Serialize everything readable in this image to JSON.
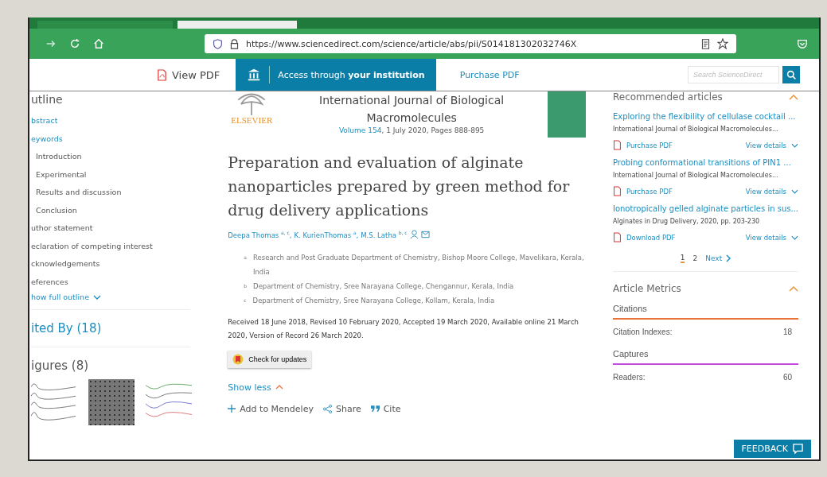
{
  "browser": {
    "url": "https://www.sciencedirect.com/science/article/abs/pii/S014181302032746X"
  },
  "header": {
    "view_pdf": "View PDF",
    "access": {
      "prefix": "Access through ",
      "bold": "your institution"
    },
    "purchase": "Purchase PDF",
    "search": {
      "placeholder": "Search ScienceDirect"
    }
  },
  "outline": {
    "title": "utline",
    "items": [
      {
        "label": "bstract",
        "kind": "link"
      },
      {
        "label": "eywords",
        "kind": "link"
      },
      {
        "label": "Introduction",
        "kind": "section"
      },
      {
        "label": "Experimental",
        "kind": "section"
      },
      {
        "label": "Results and discussion",
        "kind": "section"
      },
      {
        "label": "Conclusion",
        "kind": "section"
      },
      {
        "label": "uthor statement",
        "kind": "plain"
      },
      {
        "label": "eclaration of competing interest",
        "kind": "plain"
      },
      {
        "label": "cknowledgements",
        "kind": "plain"
      },
      {
        "label": "eferences",
        "kind": "plain"
      }
    ],
    "show_full": "how full outline"
  },
  "cited_by": "ited By (18)",
  "figures": {
    "title": "igures (8)"
  },
  "journal": {
    "publisher": "ELSEVIER",
    "name": "International Journal of Biological Macromolecules",
    "volume": "Volume 154",
    "details": ", 1 July 2020, Pages 888-895"
  },
  "article": {
    "title": "Preparation and evaluation of alginate nanoparticles prepared by green method for drug delivery applications",
    "authors": [
      {
        "name": "Deepa Thomas",
        "marks": "a, c",
        "sep": ","
      },
      {
        "name": "K. KurienThomas",
        "marks": "a",
        "sep": ","
      },
      {
        "name": "M.S. Latha",
        "marks": "b, c"
      }
    ],
    "affiliations": [
      {
        "mark": "a",
        "text": "Research and Post Graduate Department of Chemistry, Bishop Moore College, Mavelikara, Kerala, India"
      },
      {
        "mark": "b",
        "text": "Department of Chemistry, Sree Narayana College, Chengannur, Kerala, India"
      },
      {
        "mark": "c",
        "text": "Department of Chemistry, Sree Narayana College, Kollam, Kerala, India"
      }
    ],
    "history": "Received 18 June 2018, Revised 10 February 2020, Accepted 19 March 2020, Available online 21 March 2020, Version of Record 26 March 2020.",
    "check_updates": "Check for updates",
    "show_less": "Show less",
    "actions": [
      {
        "label": "Add to Mendeley",
        "kind": "add"
      },
      {
        "label": "Share",
        "kind": "share"
      },
      {
        "label": "Cite",
        "kind": "cite"
      }
    ]
  },
  "recommended": {
    "title": "Recommended articles",
    "items": [
      {
        "title": "Exploring the flexibility of cellulase cocktail ...",
        "source": "International Journal of Biological Macromolecules...",
        "pdf": "Purchase PDF",
        "details": "View details"
      },
      {
        "title": "Probing conformational transitions of PIN1 ...",
        "source": "International Journal of Biological Macromolecules...",
        "pdf": "Purchase PDF",
        "details": "View details"
      },
      {
        "title": "Ionotropically gelled alginate particles in sus...",
        "source": "Alginates in Drug Delivery, 2020, pp. 203-230",
        "pdf": "Download PDF",
        "details": "View details"
      }
    ],
    "pages": [
      {
        "label": "1",
        "selected": true
      },
      {
        "label": "2",
        "selected": false
      }
    ],
    "next": "Next"
  },
  "metrics": {
    "title": "Article Metrics",
    "sections": [
      {
        "title": "Citations",
        "color": "#e8743b",
        "rows": [
          {
            "label": "Citation Indexes:",
            "value": "18"
          }
        ]
      },
      {
        "title": "Captures",
        "color": "#c44be0",
        "rows": [
          {
            "label": "Readers:",
            "value": "60"
          }
        ]
      }
    ]
  },
  "feedback": "FEEDBACK"
}
